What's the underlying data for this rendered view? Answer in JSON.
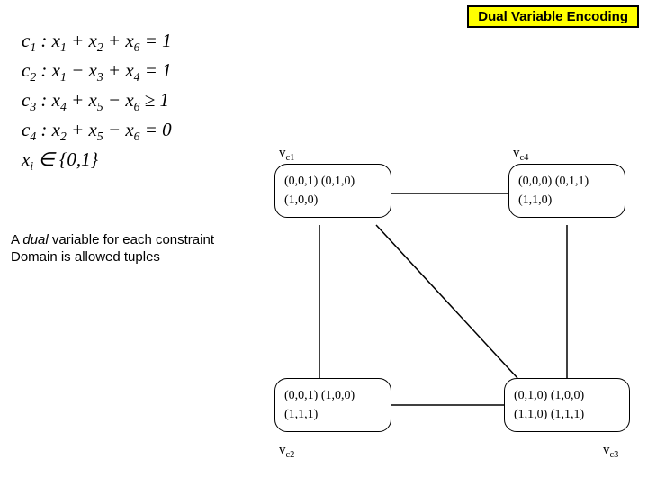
{
  "title": "Dual Variable Encoding",
  "constraints": {
    "c1": "c₁ : x₁ + x₂ + x₆ = 1",
    "c2": "c₂ : x₁ − x₃ + x₄ = 1",
    "c3": "c₃ : x₄ + x₅ − x₆ ≥ 1",
    "c4": "c₄ : x₂ + x₅ − x₆ = 0",
    "domain": "xᵢ ∈ {0,1}"
  },
  "note": {
    "line1_html": "A <em>dual</em> variable for each constraint",
    "line1_plain": "A dual variable for each constraint",
    "line2": "Domain is allowed tuples"
  },
  "nodes": {
    "vc1": {
      "label": "v꜀₁",
      "row1": "(0,0,1) (0,1,0)",
      "row2": "(1,0,0)"
    },
    "vc4": {
      "label": "v꜀₄",
      "row1": "(0,0,0) (0,1,1)",
      "row2": "(1,1,0)"
    },
    "vc2": {
      "label": "v꜀₂",
      "row1": "(0,0,1) (1,0,0)",
      "row2": "(1,1,1)"
    },
    "vc3": {
      "label": "v꜀₃",
      "row1": "(0,1,0) (1,0,0)",
      "row2": "(1,1,0) (1,1,1)"
    }
  }
}
